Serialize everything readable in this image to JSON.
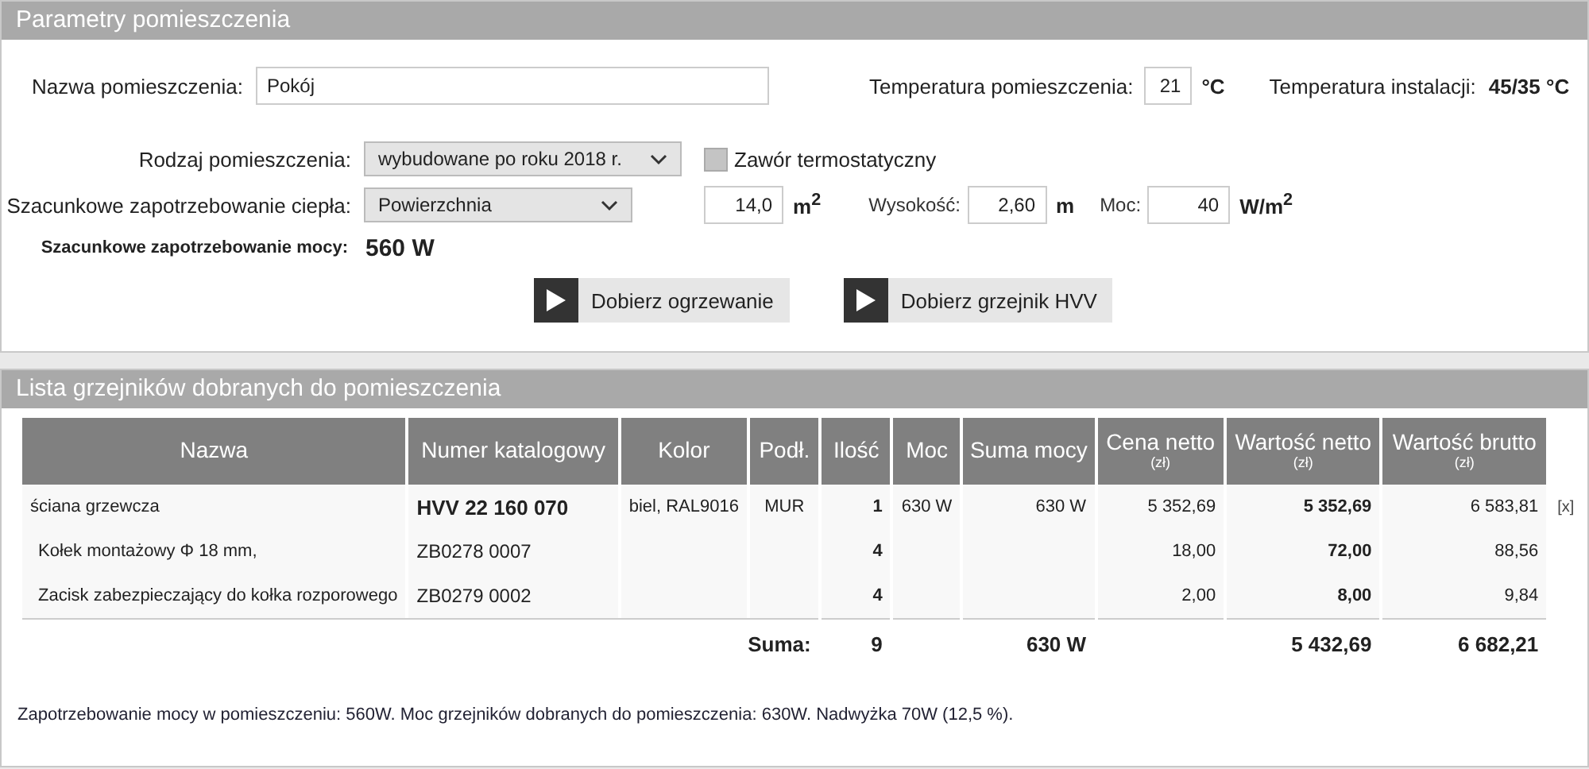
{
  "room_panel": {
    "title": "Parametry pomieszczenia",
    "name_label": "Nazwa pomieszczenia:",
    "name_value": "Pokój",
    "room_temp_label": "Temperatura pomieszczenia:",
    "room_temp_value": "21",
    "room_temp_unit": "°C",
    "install_temp_label": "Temperatura instalacji:",
    "install_temp_value": "45/35 °C",
    "room_type_label": "Rodzaj pomieszczenia:",
    "room_type_value": "wybudowane po roku 2018 r.",
    "thermostatic_valve": {
      "label": "Zawór termostatyczny",
      "checked": false
    },
    "heat_demand_label": "Szacunkowe zapotrzebowanie ciepła:",
    "heat_demand_method": "Powierzchnia",
    "area_value": "14,0",
    "area_unit": "m$^{2}$",
    "height_label": "Wysokość:",
    "height_value": "2,60",
    "height_unit": "m",
    "power_label": "Moc:",
    "power_value": "40",
    "power_unit": "W/m$^{2}$",
    "power_demand_label": "Szacunkowe zapotrzebowanie mocy:",
    "power_demand_value": "560 W",
    "buttons": [
      "Dobierz ogrzewanie",
      "Dobierz grzejnik HVV"
    ]
  },
  "radiator_list": {
    "title": "Lista grzejników dobranych do pomieszczenia",
    "columns": [
      {
        "label": "Nazwa"
      },
      {
        "label": "Numer katalogowy"
      },
      {
        "label": "Kolor"
      },
      {
        "label": "Podł."
      },
      {
        "label": "Ilość"
      },
      {
        "label": "Moc"
      },
      {
        "label": "Suma mocy"
      },
      {
        "label": "Cena netto",
        "unit": "(zł)"
      },
      {
        "label": "Wartość netto",
        "unit": "(zł)"
      },
      {
        "label": "Wartość brutto",
        "unit": "(zł)"
      }
    ],
    "rows": [
      {
        "kind": "radiator",
        "name": "ściana grzewcza",
        "catalog": "HVV 22 160 070",
        "finish": "biel, RAL9016",
        "mount": "MUR",
        "qty": "1",
        "power": "630 W",
        "power_sum": "630 W",
        "net_price": "5 352,69",
        "net_value": "5 352,69",
        "gross_value": "6 583,81",
        "remove": "[x]"
      },
      {
        "kind": "accessory",
        "name": "Kołek montażowy Φ 18 mm,",
        "catalog": "ZB0278 0007",
        "qty": "4",
        "net_price": "18,00",
        "net_value": "72,00",
        "gross_value": "88,56"
      },
      {
        "kind": "accessory",
        "name": "Zacisk zabezpieczający do kołka rozporowego",
        "catalog": "ZB0279 0002",
        "qty": "4",
        "net_price": "2,00",
        "net_value": "8,00",
        "gross_value": "9,84"
      }
    ],
    "totals": {
      "label": "Suma:",
      "qty": "9",
      "power_sum": "630 W",
      "net_value": "5 432,69",
      "gross_value": "6 682,21"
    },
    "summary": "Zapotrzebowanie mocy w pomieszczeniu: 560W. Moc grzejników dobranych do pomieszczenia: 630W. Nadwyżka 70W (12,5 %)."
  }
}
